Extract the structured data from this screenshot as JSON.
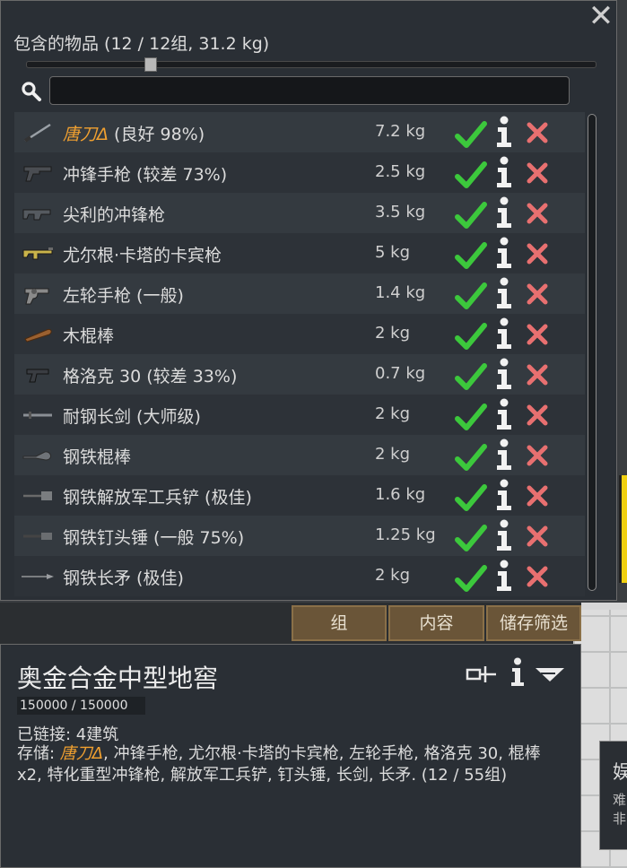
{
  "window": {
    "title": "包含的物品 (12 / 12组, 31.2 kg)",
    "close_label": "✕",
    "slider": {
      "fraction": 0.21
    },
    "search": {
      "value": "",
      "placeholder": ""
    }
  },
  "items": [
    {
      "prefix": "唐刀Δ",
      "name": " (良好 98%)",
      "mass": "7.2 kg",
      "icon": "katana-icon"
    },
    {
      "prefix": "",
      "name": "冲锋手枪 (较差 73%)",
      "mass": "2.5 kg",
      "icon": "machine-pistol-icon"
    },
    {
      "prefix": "",
      "name": "尖利的冲锋枪",
      "mass": "3.5 kg",
      "icon": "smg-icon"
    },
    {
      "prefix": "",
      "name": "尤尔根·卡塔的卡宾枪",
      "mass": "5 kg",
      "icon": "carbine-icon"
    },
    {
      "prefix": "",
      "name": "左轮手枪 (一般)",
      "mass": "1.4 kg",
      "icon": "revolver-icon"
    },
    {
      "prefix": "",
      "name": "木棍棒",
      "mass": "2 kg",
      "icon": "wood-club-icon"
    },
    {
      "prefix": "",
      "name": "格洛克 30 (较差 33%)",
      "mass": "0.7 kg",
      "icon": "pistol-icon"
    },
    {
      "prefix": "",
      "name": "耐钢长剑 (大师级)",
      "mass": "2 kg",
      "icon": "longsword-icon"
    },
    {
      "prefix": "",
      "name": "钢铁棍棒",
      "mass": "2 kg",
      "icon": "steel-club-icon"
    },
    {
      "prefix": "",
      "name": "钢铁解放军工兵铲 (极佳)",
      "mass": "1.6 kg",
      "icon": "shovel-icon"
    },
    {
      "prefix": "",
      "name": "钢铁钉头锤 (一般 75%)",
      "mass": "1.25 kg",
      "icon": "mace-icon"
    },
    {
      "prefix": "",
      "name": "钢铁长矛 (极佳)",
      "mass": "2 kg",
      "icon": "spear-icon"
    }
  ],
  "tabs": [
    "组",
    "内容",
    "储存筛选"
  ],
  "inspect": {
    "title": "奥金合金中型地窖",
    "hp": "150000 / 150000",
    "linked": "已链接: 4建筑",
    "storage_label": "存储: ",
    "storage_highlight": "唐刀Δ",
    "storage_rest": ", 冲锋手枪, 尤尔根·卡塔的卡宾枪, 左轮手枪, 格洛克 30, 棍棒 x2, 特化重型冲锋枪, 解放军工兵铲, 钉头锤, 长剑, 长矛. (12 / 55组)"
  },
  "side_panel": {
    "t1": "娱",
    "t2": "难",
    "t3": "非"
  },
  "colors": {
    "highlight": "#f0a030",
    "ok": "#3cc83c",
    "delete": "#e87070",
    "tab": "#6a5538"
  }
}
